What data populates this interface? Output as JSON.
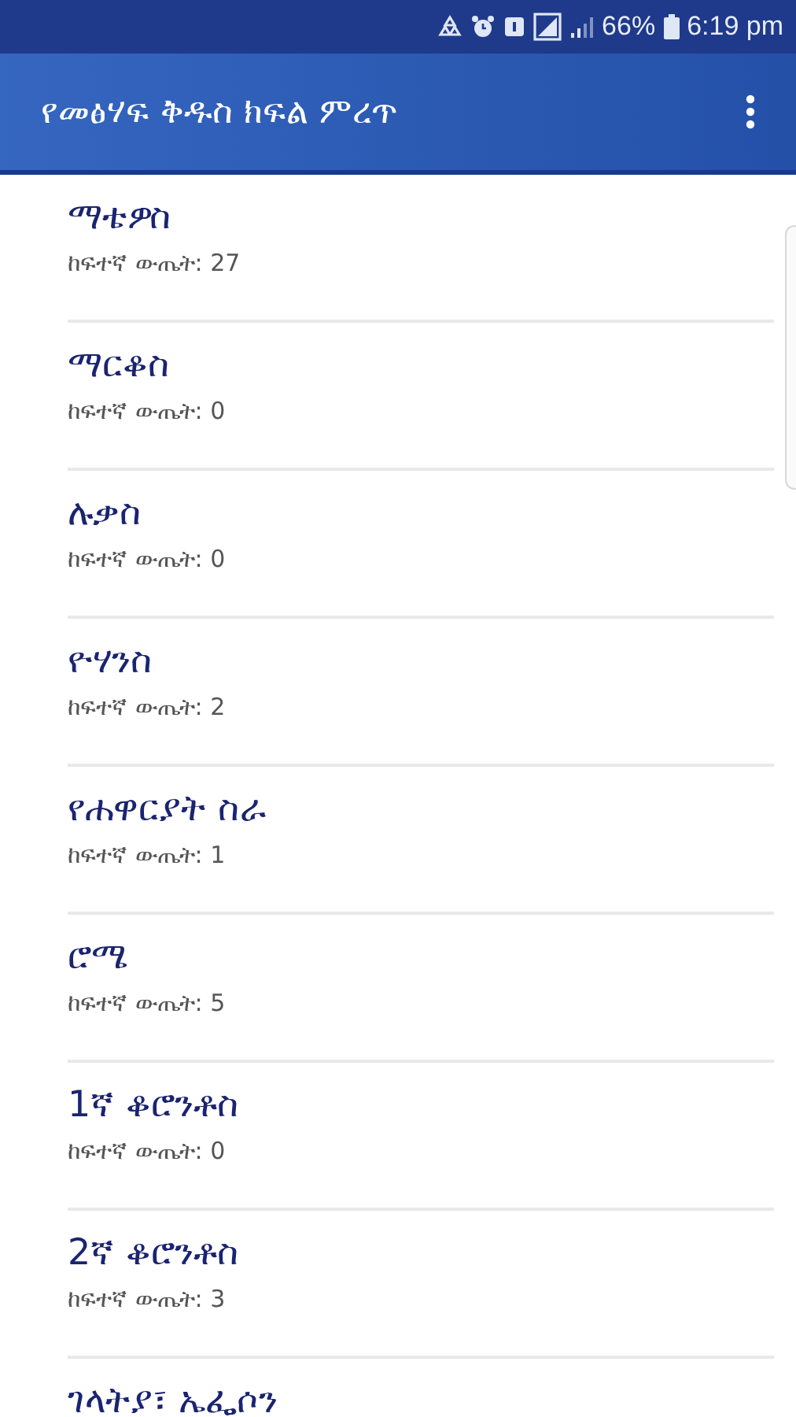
{
  "status_bar": {
    "battery": "66%",
    "time": "6:19 pm"
  },
  "app_bar": {
    "title": "የመፅሃፍ ቅዱስ ክፍል ምረጥ"
  },
  "books": [
    {
      "name": "ማቴዎስ",
      "score": "ከፍተኛ ውጤት: 27"
    },
    {
      "name": "ማርቆስ",
      "score": "ከፍተኛ ውጤት: 0"
    },
    {
      "name": "ሉቃስ",
      "score": "ከፍተኛ ውጤት: 0"
    },
    {
      "name": "ዮሃንስ",
      "score": "ከፍተኛ ውጤት: 2"
    },
    {
      "name": "የሐዋርያት ስራ",
      "score": "ከፍተኛ ውጤት: 1"
    },
    {
      "name": "ሮሜ",
      "score": "ከፍተኛ ውጤት: 5"
    },
    {
      "name": "1ኛ ቆሮንቶስ",
      "score": "ከፍተኛ ውጤት: 0"
    },
    {
      "name": "2ኛ ቆሮንቶስ",
      "score": "ከፍተኛ ውጤት: 3"
    },
    {
      "name": "ገላትያ፣ ኤፌሶን"
    }
  ]
}
